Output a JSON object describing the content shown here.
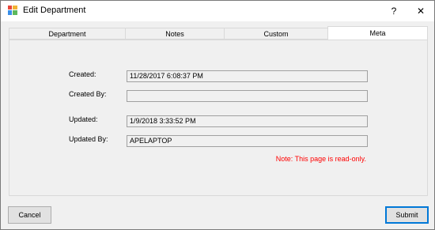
{
  "window": {
    "title": "Edit Department",
    "help_glyph": "?",
    "close_glyph": "✕"
  },
  "tabs": [
    {
      "label": "Department",
      "active": false
    },
    {
      "label": "Notes",
      "active": false
    },
    {
      "label": "Custom",
      "active": false
    },
    {
      "label": "Meta",
      "active": true
    }
  ],
  "meta": {
    "created_label": "Created:",
    "created_value": "11/28/2017 6:08:37 PM",
    "created_by_label": "Created By:",
    "created_by_value": "",
    "updated_label": "Updated:",
    "updated_value": "1/9/2018 3:33:52 PM",
    "updated_by_label": "Updated By:",
    "updated_by_value": "APELAPTOP",
    "note": "Note: This page is read-only."
  },
  "buttons": {
    "cancel": "Cancel",
    "submit": "Submit"
  },
  "colors": {
    "note": "#ff0000",
    "accent": "#0078d7"
  }
}
